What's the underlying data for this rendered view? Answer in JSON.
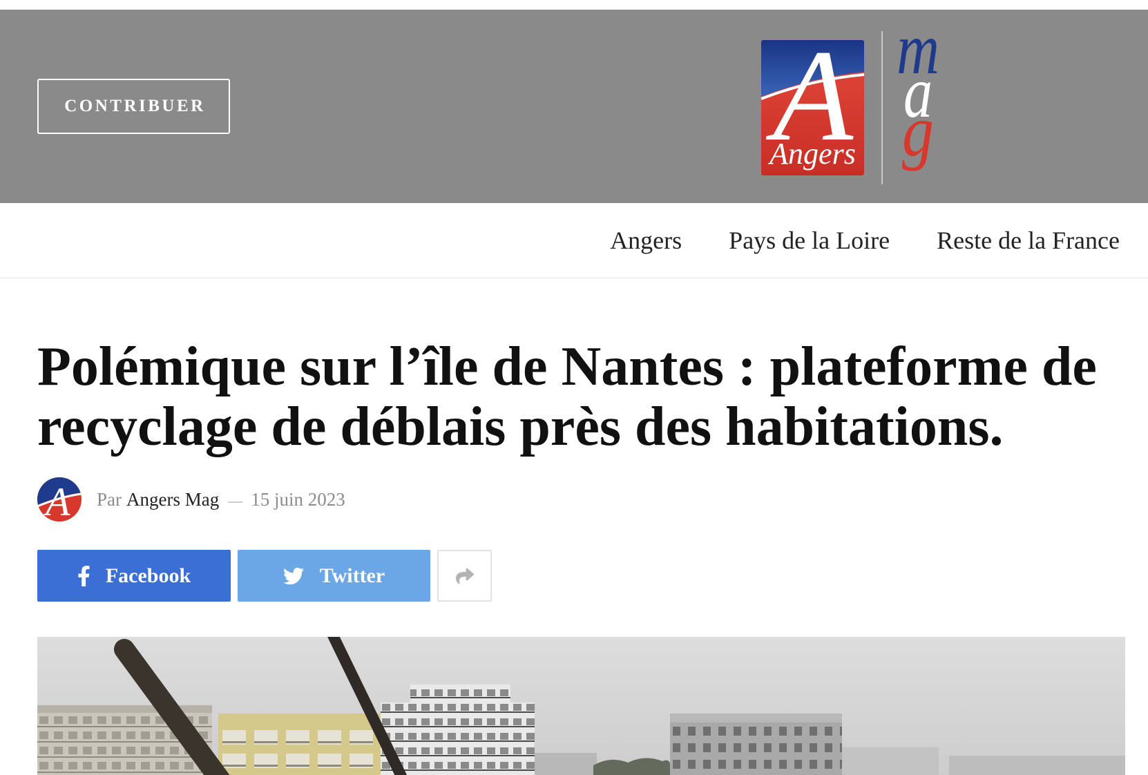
{
  "header": {
    "contribute_label": "CONTRIBUER",
    "background": "#8a8a8a"
  },
  "logo": {
    "initial": "A",
    "city": "Angers",
    "mag_letters": [
      "m",
      "a",
      "g"
    ],
    "colors": {
      "blue": "#1f3a8a",
      "red": "#d8372c",
      "white": "#ffffff"
    }
  },
  "nav": {
    "items": [
      {
        "label": "Angers"
      },
      {
        "label": "Pays de la Loire"
      },
      {
        "label": "Reste de la France"
      }
    ]
  },
  "article": {
    "title": "Polémique sur l’île de Nantes : plateforme de recyclage de déblais près des habitations.",
    "meta": {
      "by_label": "Par",
      "author": "Angers Mag",
      "separator": "—",
      "date": "15 juin 2023"
    },
    "share": {
      "facebook": {
        "label": "Facebook",
        "icon": "facebook-f-icon",
        "color": "#3c6fd5"
      },
      "twitter": {
        "label": "Twitter",
        "icon": "twitter-bird-icon",
        "color": "#6ba7e6"
      },
      "more": {
        "icon": "share-arrow-icon"
      }
    }
  }
}
